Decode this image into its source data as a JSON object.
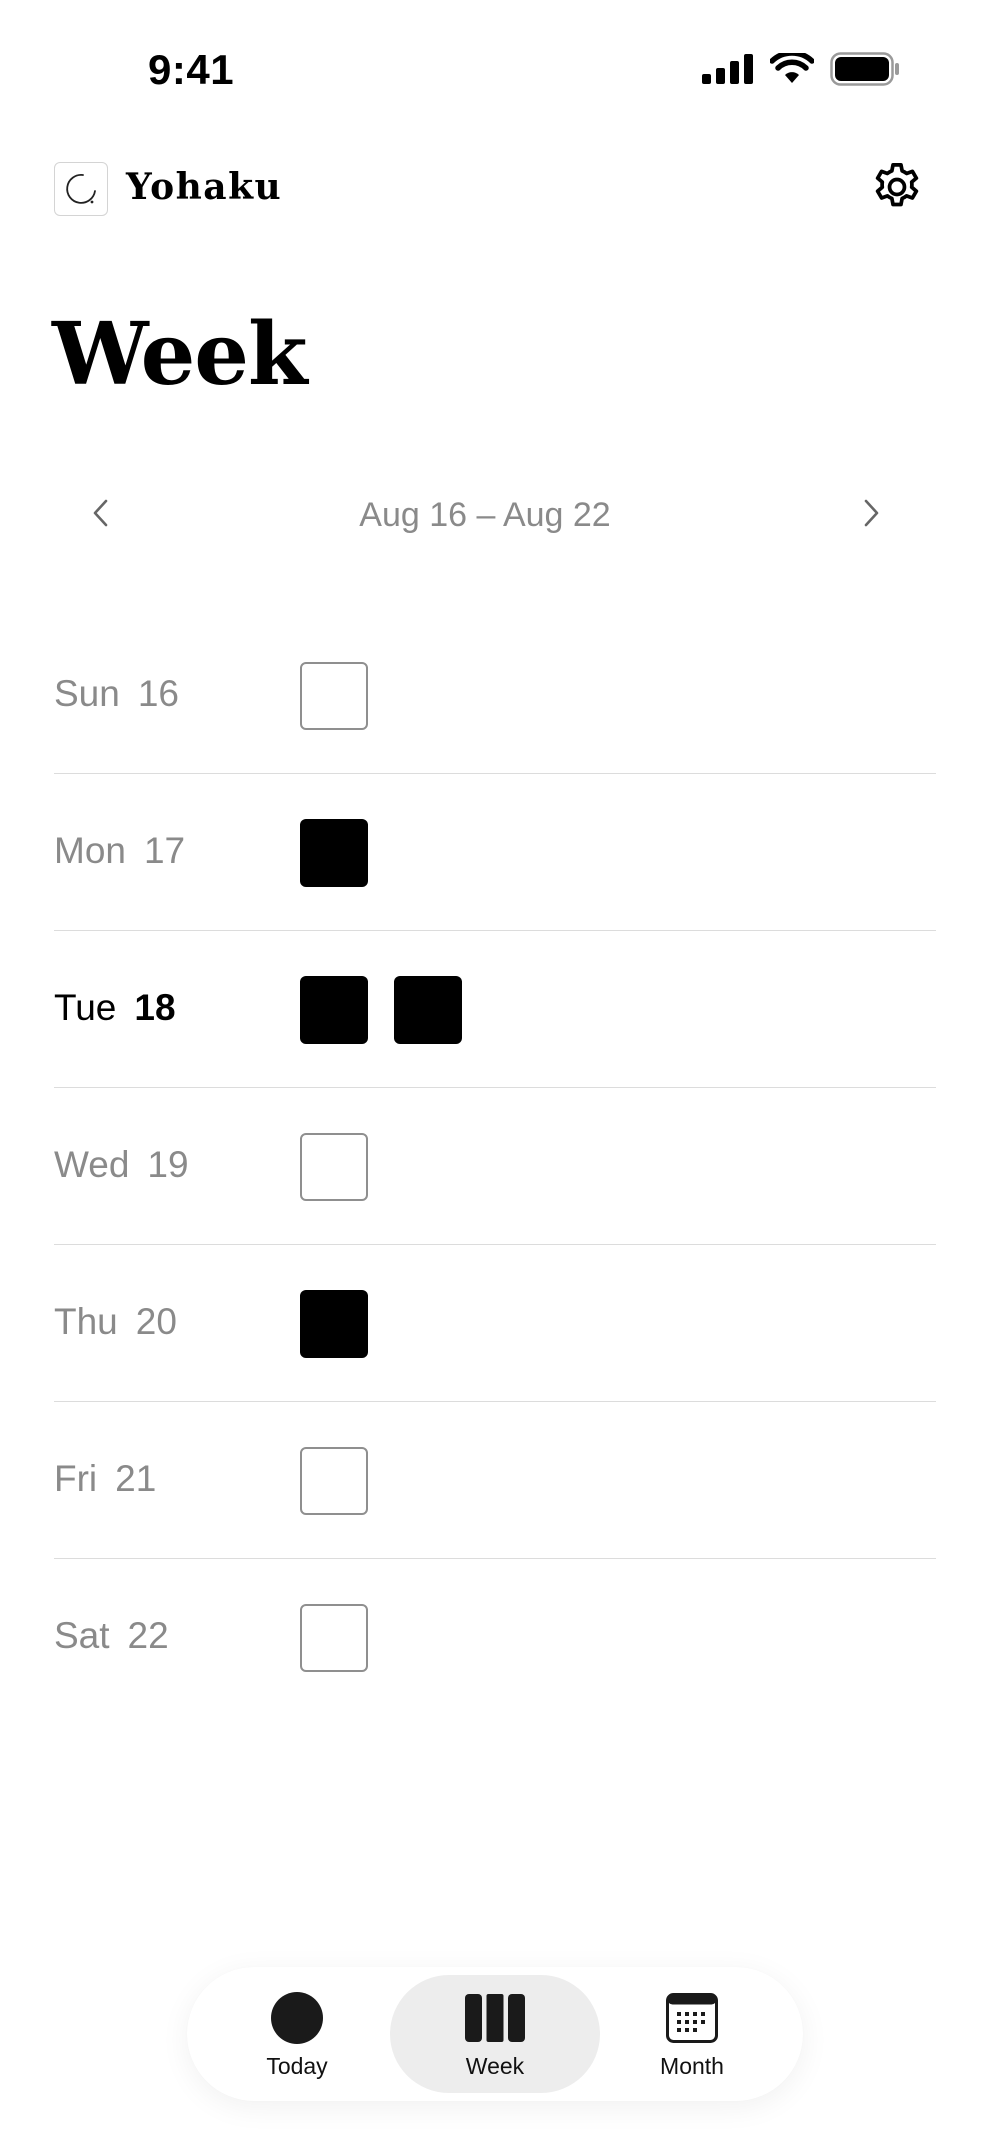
{
  "status_bar": {
    "time": "9:41",
    "icons": [
      "cellular-signal-icon",
      "wifi-icon",
      "battery-icon"
    ]
  },
  "header": {
    "app_name": "Yohaku",
    "logo_icon": "enso-circle-icon",
    "settings_icon": "gear-icon"
  },
  "page": {
    "title": "Week"
  },
  "week_nav": {
    "range": "Aug 16 – Aug 22",
    "prev_icon": "chevron-left-icon",
    "next_icon": "chevron-right-icon"
  },
  "days": [
    {
      "weekday": "Sun",
      "date": "16",
      "marks": [
        "empty"
      ],
      "today": false
    },
    {
      "weekday": "Mon",
      "date": "17",
      "marks": [
        "filled"
      ],
      "today": false
    },
    {
      "weekday": "Tue",
      "date": "18",
      "marks": [
        "filled",
        "filled"
      ],
      "today": true
    },
    {
      "weekday": "Wed",
      "date": "19",
      "marks": [
        "empty"
      ],
      "today": false
    },
    {
      "weekday": "Thu",
      "date": "20",
      "marks": [
        "filled"
      ],
      "today": false
    },
    {
      "weekday": "Fri",
      "date": "21",
      "marks": [
        "empty"
      ],
      "today": false
    },
    {
      "weekday": "Sat",
      "date": "22",
      "marks": [
        "empty"
      ],
      "today": false
    }
  ],
  "tabs": [
    {
      "label": "Today",
      "icon": "filled-circle-icon",
      "active": false
    },
    {
      "label": "Week",
      "icon": "week-columns-icon",
      "active": true
    },
    {
      "label": "Month",
      "icon": "calendar-grid-icon",
      "active": false
    }
  ],
  "colors": {
    "accent": "#000000",
    "muted_text": "#8a8a8a",
    "divider": "#dcdcdc",
    "active_tab_bg": "#ededed"
  }
}
